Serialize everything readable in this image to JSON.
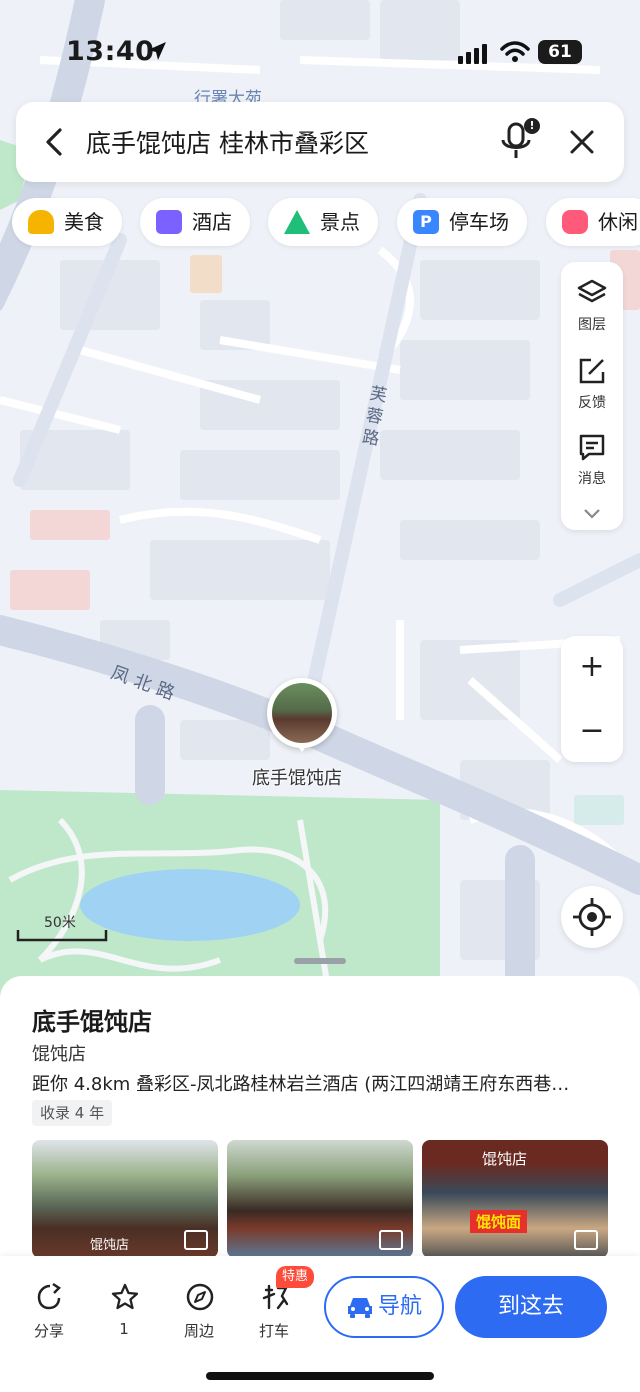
{
  "status": {
    "time": "13:40",
    "battery": "61"
  },
  "search": {
    "query": "底手馄饨店 桂林市叠彩区",
    "mic_badge": "!"
  },
  "chips": [
    {
      "label": "美食",
      "color": "#f4b400"
    },
    {
      "label": "酒店",
      "color": "#7b61ff"
    },
    {
      "label": "景点",
      "color": "#1fbf7a"
    },
    {
      "label": "停车场",
      "color": "#3a86ff"
    },
    {
      "label": "休闲",
      "color": "#ff5a7a"
    }
  ],
  "map": {
    "top_label": "行署大苑",
    "road_furong": "芙蓉路",
    "road_fengbei": "凤北路",
    "pin_label": "底手馄饨店",
    "scale": "50米"
  },
  "tools": {
    "layers": "图层",
    "feedback": "反馈",
    "messages": "消息"
  },
  "zoom": {
    "in": "+",
    "out": "−"
  },
  "poi": {
    "title": "底手馄饨店",
    "category": "馄饨店",
    "distance": "距你 4.8km   叠彩区-凤北路桂林岩兰酒店 (两江四湖靖王府东西巷…",
    "tag": "收录 4 年",
    "photo_texts": [
      "馄饨店",
      "馄饨面",
      "馄饨店"
    ]
  },
  "actions": {
    "share": "分享",
    "favorite": "1",
    "nearby": "周边",
    "taxi": "打车",
    "taxi_badge": "特惠",
    "navigate": "导航",
    "go": "到这去"
  },
  "colors": {
    "accent": "#2d6bf3",
    "badge": "#ff4b3a"
  }
}
